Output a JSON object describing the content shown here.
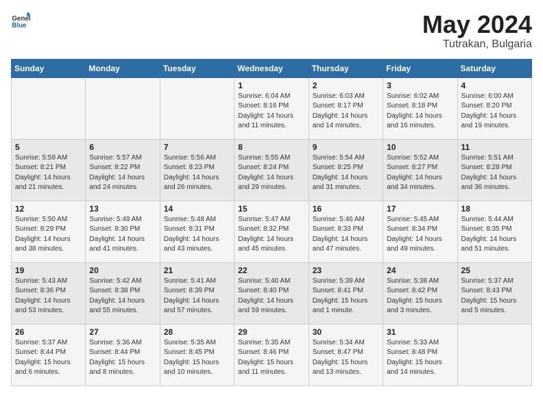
{
  "logo": {
    "general": "General",
    "blue": "Blue"
  },
  "title": {
    "month": "May 2024",
    "location": "Tutrakan, Bulgaria"
  },
  "weekdays": [
    "Sunday",
    "Monday",
    "Tuesday",
    "Wednesday",
    "Thursday",
    "Friday",
    "Saturday"
  ],
  "weeks": [
    [
      {
        "day": "",
        "sunrise": "",
        "sunset": "",
        "daylight": ""
      },
      {
        "day": "",
        "sunrise": "",
        "sunset": "",
        "daylight": ""
      },
      {
        "day": "",
        "sunrise": "",
        "sunset": "",
        "daylight": ""
      },
      {
        "day": "1",
        "sunrise": "Sunrise: 6:04 AM",
        "sunset": "Sunset: 8:16 PM",
        "daylight": "Daylight: 14 hours and 11 minutes."
      },
      {
        "day": "2",
        "sunrise": "Sunrise: 6:03 AM",
        "sunset": "Sunset: 8:17 PM",
        "daylight": "Daylight: 14 hours and 14 minutes."
      },
      {
        "day": "3",
        "sunrise": "Sunrise: 6:02 AM",
        "sunset": "Sunset: 8:18 PM",
        "daylight": "Daylight: 14 hours and 16 minutes."
      },
      {
        "day": "4",
        "sunrise": "Sunrise: 6:00 AM",
        "sunset": "Sunset: 8:20 PM",
        "daylight": "Daylight: 14 hours and 19 minutes."
      }
    ],
    [
      {
        "day": "5",
        "sunrise": "Sunrise: 5:59 AM",
        "sunset": "Sunset: 8:21 PM",
        "daylight": "Daylight: 14 hours and 21 minutes."
      },
      {
        "day": "6",
        "sunrise": "Sunrise: 5:57 AM",
        "sunset": "Sunset: 8:22 PM",
        "daylight": "Daylight: 14 hours and 24 minutes."
      },
      {
        "day": "7",
        "sunrise": "Sunrise: 5:56 AM",
        "sunset": "Sunset: 8:23 PM",
        "daylight": "Daylight: 14 hours and 26 minutes."
      },
      {
        "day": "8",
        "sunrise": "Sunrise: 5:55 AM",
        "sunset": "Sunset: 8:24 PM",
        "daylight": "Daylight: 14 hours and 29 minutes."
      },
      {
        "day": "9",
        "sunrise": "Sunrise: 5:54 AM",
        "sunset": "Sunset: 8:25 PM",
        "daylight": "Daylight: 14 hours and 31 minutes."
      },
      {
        "day": "10",
        "sunrise": "Sunrise: 5:52 AM",
        "sunset": "Sunset: 8:27 PM",
        "daylight": "Daylight: 14 hours and 34 minutes."
      },
      {
        "day": "11",
        "sunrise": "Sunrise: 5:51 AM",
        "sunset": "Sunset: 8:28 PM",
        "daylight": "Daylight: 14 hours and 36 minutes."
      }
    ],
    [
      {
        "day": "12",
        "sunrise": "Sunrise: 5:50 AM",
        "sunset": "Sunset: 8:29 PM",
        "daylight": "Daylight: 14 hours and 38 minutes."
      },
      {
        "day": "13",
        "sunrise": "Sunrise: 5:49 AM",
        "sunset": "Sunset: 8:30 PM",
        "daylight": "Daylight: 14 hours and 41 minutes."
      },
      {
        "day": "14",
        "sunrise": "Sunrise: 5:48 AM",
        "sunset": "Sunset: 8:31 PM",
        "daylight": "Daylight: 14 hours and 43 minutes."
      },
      {
        "day": "15",
        "sunrise": "Sunrise: 5:47 AM",
        "sunset": "Sunset: 8:32 PM",
        "daylight": "Daylight: 14 hours and 45 minutes."
      },
      {
        "day": "16",
        "sunrise": "Sunrise: 5:46 AM",
        "sunset": "Sunset: 8:33 PM",
        "daylight": "Daylight: 14 hours and 47 minutes."
      },
      {
        "day": "17",
        "sunrise": "Sunrise: 5:45 AM",
        "sunset": "Sunset: 8:34 PM",
        "daylight": "Daylight: 14 hours and 49 minutes."
      },
      {
        "day": "18",
        "sunrise": "Sunrise: 5:44 AM",
        "sunset": "Sunset: 8:35 PM",
        "daylight": "Daylight: 14 hours and 51 minutes."
      }
    ],
    [
      {
        "day": "19",
        "sunrise": "Sunrise: 5:43 AM",
        "sunset": "Sunset: 8:36 PM",
        "daylight": "Daylight: 14 hours and 53 minutes."
      },
      {
        "day": "20",
        "sunrise": "Sunrise: 5:42 AM",
        "sunset": "Sunset: 8:38 PM",
        "daylight": "Daylight: 14 hours and 55 minutes."
      },
      {
        "day": "21",
        "sunrise": "Sunrise: 5:41 AM",
        "sunset": "Sunset: 8:39 PM",
        "daylight": "Daylight: 14 hours and 57 minutes."
      },
      {
        "day": "22",
        "sunrise": "Sunrise: 5:40 AM",
        "sunset": "Sunset: 8:40 PM",
        "daylight": "Daylight: 14 hours and 59 minutes."
      },
      {
        "day": "23",
        "sunrise": "Sunrise: 5:39 AM",
        "sunset": "Sunset: 8:41 PM",
        "daylight": "Daylight: 15 hours and 1 minute."
      },
      {
        "day": "24",
        "sunrise": "Sunrise: 5:38 AM",
        "sunset": "Sunset: 8:42 PM",
        "daylight": "Daylight: 15 hours and 3 minutes."
      },
      {
        "day": "25",
        "sunrise": "Sunrise: 5:37 AM",
        "sunset": "Sunset: 8:43 PM",
        "daylight": "Daylight: 15 hours and 5 minutes."
      }
    ],
    [
      {
        "day": "26",
        "sunrise": "Sunrise: 5:37 AM",
        "sunset": "Sunset: 8:44 PM",
        "daylight": "Daylight: 15 hours and 6 minutes."
      },
      {
        "day": "27",
        "sunrise": "Sunrise: 5:36 AM",
        "sunset": "Sunset: 8:44 PM",
        "daylight": "Daylight: 15 hours and 8 minutes."
      },
      {
        "day": "28",
        "sunrise": "Sunrise: 5:35 AM",
        "sunset": "Sunset: 8:45 PM",
        "daylight": "Daylight: 15 hours and 10 minutes."
      },
      {
        "day": "29",
        "sunrise": "Sunrise: 5:35 AM",
        "sunset": "Sunset: 8:46 PM",
        "daylight": "Daylight: 15 hours and 11 minutes."
      },
      {
        "day": "30",
        "sunrise": "Sunrise: 5:34 AM",
        "sunset": "Sunset: 8:47 PM",
        "daylight": "Daylight: 15 hours and 13 minutes."
      },
      {
        "day": "31",
        "sunrise": "Sunrise: 5:33 AM",
        "sunset": "Sunset: 8:48 PM",
        "daylight": "Daylight: 15 hours and 14 minutes."
      },
      {
        "day": "",
        "sunrise": "",
        "sunset": "",
        "daylight": ""
      }
    ]
  ]
}
